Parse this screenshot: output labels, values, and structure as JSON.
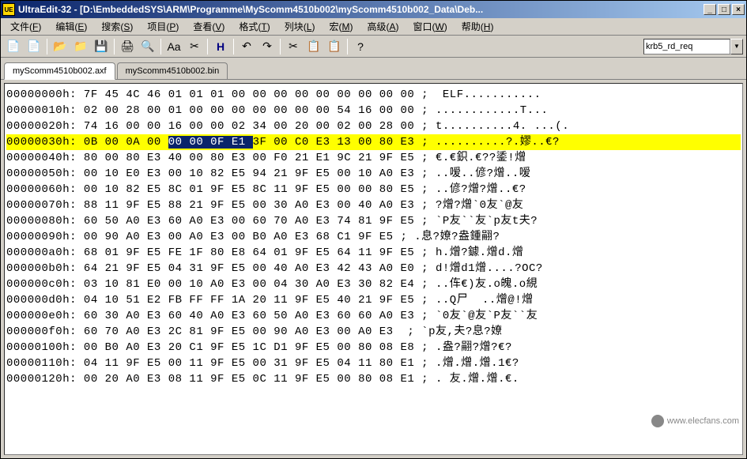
{
  "title": "UltraEdit-32 - [D:\\EmbeddedSYS\\ARM\\Programme\\MyScomm4510b002\\myScomm4510b002_Data\\Deb...",
  "app_icon_text": "UE",
  "win_btns": {
    "min": "_",
    "max": "□",
    "close": "×"
  },
  "menu": [
    {
      "label": "文件",
      "key": "F"
    },
    {
      "label": "编辑",
      "key": "E"
    },
    {
      "label": "搜索",
      "key": "S"
    },
    {
      "label": "项目",
      "key": "P"
    },
    {
      "label": "查看",
      "key": "V"
    },
    {
      "label": "格式",
      "key": "T"
    },
    {
      "label": "列块",
      "key": "L"
    },
    {
      "label": "宏",
      "key": "M"
    },
    {
      "label": "高级",
      "key": "A"
    },
    {
      "label": "窗口",
      "key": "W"
    },
    {
      "label": "帮助",
      "key": "H"
    }
  ],
  "toolbar_icons": [
    {
      "name": "new-file-icon",
      "glyph": "📄"
    },
    {
      "name": "new-proj-icon",
      "glyph": "📄"
    },
    {
      "name": "open-icon",
      "glyph": "📂"
    },
    {
      "name": "open-folder-icon",
      "glyph": "📁"
    },
    {
      "name": "save-icon",
      "glyph": "💾"
    },
    {
      "name": "print-icon",
      "glyph": "🖨"
    },
    {
      "name": "preview-icon",
      "glyph": "🔍"
    },
    {
      "name": "font-icon",
      "glyph": "Aa"
    },
    {
      "name": "copy-format-icon",
      "glyph": "✂"
    },
    {
      "name": "hex-mode-icon",
      "glyph": "H"
    },
    {
      "name": "undo-icon",
      "glyph": "↶"
    },
    {
      "name": "redo-icon",
      "glyph": "↷"
    },
    {
      "name": "cut-icon",
      "glyph": "✂"
    },
    {
      "name": "copy-icon",
      "glyph": "📋"
    },
    {
      "name": "paste-icon",
      "glyph": "📋"
    },
    {
      "name": "help-icon",
      "glyph": "?"
    }
  ],
  "search_value": "krb5_rd_req",
  "tabs": [
    {
      "label": "myScomm4510b002.axf",
      "active": true
    },
    {
      "label": "myScomm4510b002.bin",
      "active": false
    }
  ],
  "hex_rows": [
    {
      "off": "00000000h:",
      "hex": "7F 45 4C 46 01 01 01 00 00 00 00 00 00 00 00 00",
      "asc": ";  ELF..........."
    },
    {
      "off": "00000010h:",
      "hex": "02 00 28 00 01 00 00 00 00 00 00 00 54 16 00 00",
      "asc": "; ............T..."
    },
    {
      "off": "00000020h:",
      "hex": "74 16 00 00 16 00 00 02 34 00 20 00 02 00 28 00",
      "asc": "; t..........4. ...(."
    },
    {
      "off": "00000030h:",
      "hex_pre": "0B 00 0A 00 ",
      "hex_sel": "00 00 0F E1 ",
      "hex_post": "3F 00 C0 E3 13 00 80 E3",
      "asc": "; ..........?.嫪..€?",
      "hl": true
    },
    {
      "off": "00000040h:",
      "hex": "80 00 80 E3 40 00 80 E3 00 F0 21 E1 9C 21 9F E5",
      "asc": "; €.€鉙.€??鋈!熷"
    },
    {
      "off": "00000050h:",
      "hex": "00 10 E0 E3 00 10 82 E5 94 21 9F E5 00 10 A0 E3",
      "asc": "; ..嗳..偐?熷..嗳"
    },
    {
      "off": "00000060h:",
      "hex": "00 10 82 E5 8C 01 9F E5 8C 11 9F E5 00 00 80 E5",
      "asc": "; ..偐?熷?熷..€?"
    },
    {
      "off": "00000070h:",
      "hex": "88 11 9F E5 88 21 9F E5 00 30 A0 E3 00 40 A0 E3",
      "asc": "; ?熷?熷`0友`@友"
    },
    {
      "off": "00000080h:",
      "hex": "60 50 A0 E3 60 A0 E3 00 60 70 A0 E3 74 81 9F E5",
      "asc": "; `P友``友`p友t夫?"
    },
    {
      "off": "00000090h:",
      "hex": "00 90 A0 E3 00 A0 E3 00 B0 A0 E3 68 C1 9F E5",
      "asc": "; .息?嫽?盎鍾翤?"
    },
    {
      "off": "000000a0h:",
      "hex": "68 01 9F E5 FE 1F 80 E8 64 01 9F E5 64 11 9F E5",
      "asc": "; h.熷?鐻.熷d.熷"
    },
    {
      "off": "000000b0h:",
      "hex": "64 21 9F E5 04 31 9F E5 00 40 A0 E3 42 43 A0 E0",
      "asc": "; d!熷d1熷....?OC?"
    },
    {
      "off": "000000c0h:",
      "hex": "03 10 81 E0 00 10 A0 E3 00 04 30 A0 E3 30 82 E4",
      "asc": "; ..伡€)友.o魄.o絸"
    },
    {
      "off": "000000d0h:",
      "hex": "04 10 51 E2 FB FF FF 1A 20 11 9F E5 40 21 9F E5",
      "asc": "; ..Q尸  ..熷@!熷"
    },
    {
      "off": "000000e0h:",
      "hex": "60 30 A0 E3 60 40 A0 E3 60 50 A0 E3 60 60 A0 E3",
      "asc": "; `0友`@友`P友``友"
    },
    {
      "off": "000000f0h:",
      "hex": "60 70 A0 E3 2C 81 9F E5 00 90 A0 E3 00 A0 E3 ",
      "asc": "; `p友,夫?息?嫽"
    },
    {
      "off": "00000100h:",
      "hex": "00 B0 A0 E3 20 C1 9F E5 1C D1 9F E5 00 80 08 E8",
      "asc": "; .盎?翤?熷?€?"
    },
    {
      "off": "00000110h:",
      "hex": "04 11 9F E5 00 11 9F E5 00 31 9F E5 04 11 80 E1",
      "asc": "; .熷.熷.熷.1€?"
    },
    {
      "off": "00000120h:",
      "hex": "00 20 A0 E3 08 11 9F E5 0C 11 9F E5 00 80 08 E1",
      "asc": "; . 友.熷.熷.€."
    }
  ],
  "watermark": "www.elecfans.com"
}
